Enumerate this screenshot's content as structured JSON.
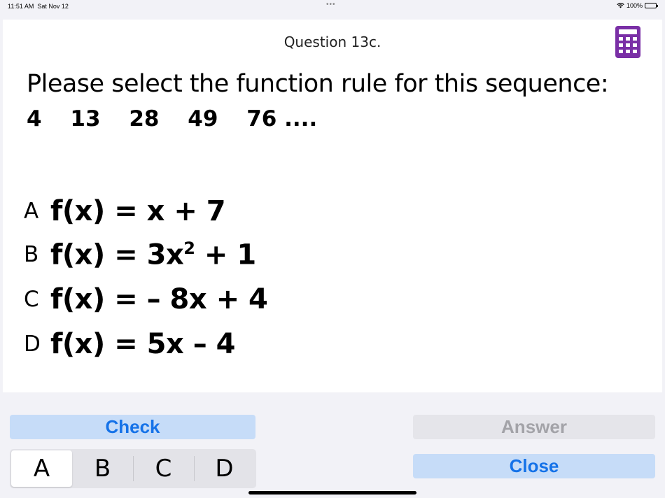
{
  "status_bar": {
    "time": "11:51 AM",
    "date": "Sat Nov 12",
    "dots": "•••",
    "battery": "100%"
  },
  "question": {
    "title": "Question 13c.",
    "prompt": "Please select the function rule for this sequence:",
    "sequence": [
      "4",
      "13",
      "28",
      "49",
      "76 ...."
    ]
  },
  "options": [
    {
      "letter": "A",
      "text": "f(x) = x + 7"
    },
    {
      "letter": "B",
      "text_before": "f(x) = 3x",
      "sup": "2",
      "text_after": " + 1"
    },
    {
      "letter": "C",
      "text": "f(x) = – 8x + 4"
    },
    {
      "letter": "D",
      "text": "f(x) = 5x – 4"
    }
  ],
  "buttons": {
    "check": "Check",
    "answer": "Answer",
    "close": "Close"
  },
  "segments": [
    "A",
    "B",
    "C",
    "D"
  ],
  "selected_segment": "A",
  "colors": {
    "accent": "#1572e8",
    "button_bg": "#c6dcf8",
    "disabled_text": "#a3a3a8",
    "calculator": "#7a2fa6"
  },
  "icons": {
    "calculator": "calculator-icon",
    "wifi": "wifi-icon",
    "battery": "battery-icon"
  }
}
